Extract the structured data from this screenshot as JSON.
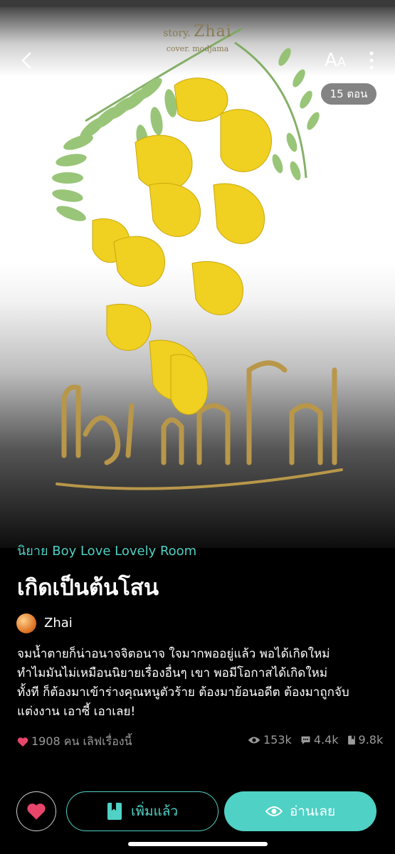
{
  "cover": {
    "story_prefix": "story.",
    "author_name": "Zhai",
    "cover_credit": "cover. modjama",
    "episodes_badge": "15 ตอน",
    "font_button": {
      "big": "A",
      "small": "A"
    }
  },
  "novel": {
    "genre": "นิยาย Boy Love Lovely Room",
    "title": "เกิดเป็นต้นโสน",
    "author": "Zhai",
    "synopsis": "จมน้ำตายก็น่าอนาจจิตอนาจ ใจมากพออยู่แล้ว พอได้เกิดใหม่\nทำไมมันไม่เหมือนนิยายเรื่องอื่นๆ เขา พอมีโอกาสได้เกิดใหม่\nทั้งที ก็ต้องมาเข้าร่างคุณหนูตัวร้าย ต้องมาย้อนอดีต ต้องมาถูกจับ\nแต่งงาน เอาซี้ เอาเลย!"
  },
  "stats": {
    "likes_text": "1908 คน เลิฟเรื่องนี้",
    "views": "153k",
    "comments": "4.4k",
    "bookmarks": "9.8k"
  },
  "actions": {
    "added_label": "เพิ่มแล้ว",
    "read_label": "อ่านเลย"
  },
  "colors": {
    "accent": "#4fd1c5",
    "heart": "#e8456b",
    "muted": "#9a9a9a"
  },
  "icons": [
    "back-icon",
    "font-size-icon",
    "more-icon",
    "heart-icon",
    "eye-icon",
    "comment-icon",
    "book-icon",
    "bookmark-icon"
  ]
}
